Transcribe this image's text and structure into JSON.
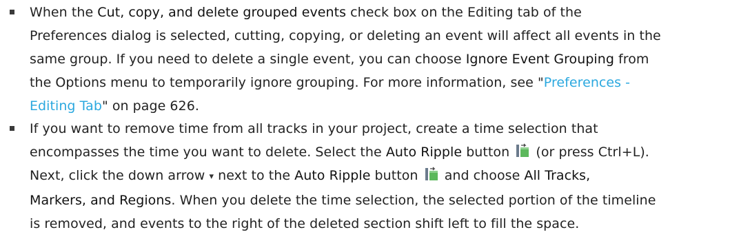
{
  "items": [
    {
      "l1a": "When the ",
      "l1b": "Cut, copy, and delete grouped events",
      "l1c": " check box on the Editing tab of the",
      "l2": "Preferences dialog is selected, cutting, copying, or deleting an event will affect all events in the",
      "l3a": "same group. If you need to delete a single event, you can choose ",
      "l3b": "Ignore Event Grouping",
      "l3c": " from",
      "l4a": "the Options menu to temporarily ignore grouping. For more information, see \"",
      "l4b": "Preferences -",
      "l5a": "Editing Tab",
      "l5b": "\" on page 626."
    },
    {
      "l1": "If you want to remove time from all tracks in your project, create a time selection that",
      "l2a": "encompasses the time you want to delete. Select the ",
      "l2b": "Auto Ripple",
      "l2c": " button",
      "l2d": " (or press Ctrl+L).",
      "l3a": "Next, click the down arrow",
      "l3b": " next to the ",
      "l3c": "Auto Ripple",
      "l3d": " button",
      "l3e": " and choose ",
      "l3f": "All Tracks,",
      "l4a": "Markers, and Regions",
      "l4b": ". When you delete the time selection, the selected portion of the timeline",
      "l5": "is removed, and events to the right of the deleted section shift left to fill the space."
    }
  ],
  "icons": {
    "auto_ripple": "auto-ripple-icon",
    "dropdown": "down-arrow-icon"
  },
  "colors": {
    "link": "#2ba8df",
    "icon_green": "#5cb85c"
  }
}
